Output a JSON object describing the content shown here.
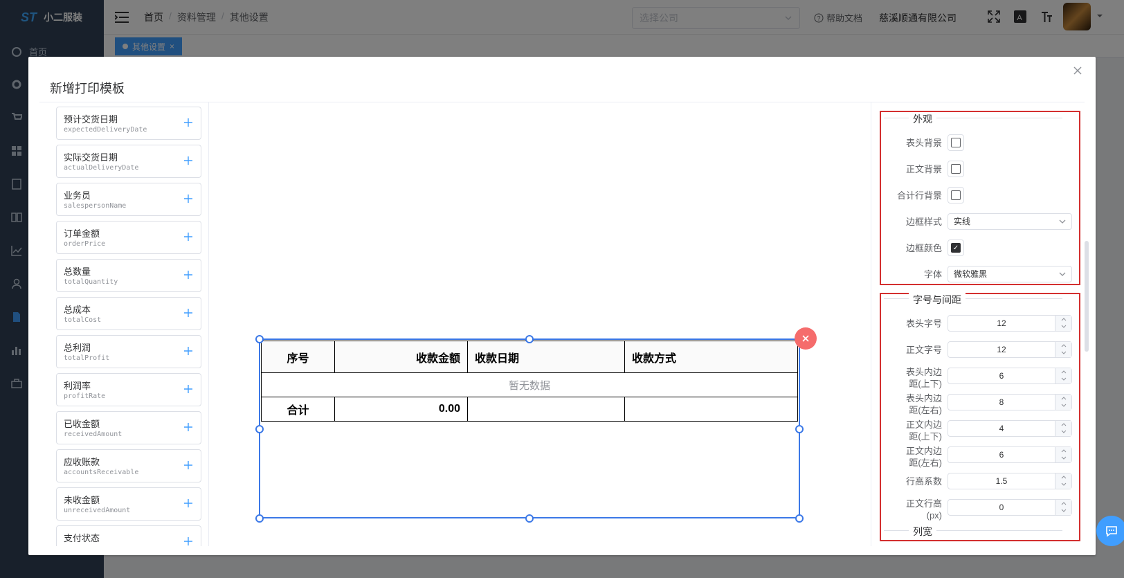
{
  "app": {
    "name": "小二服装",
    "logo_text": "ST"
  },
  "sidebar": {
    "items": [
      {
        "label": "首页",
        "icon": "dashboard-icon"
      },
      {
        "label": "",
        "icon": "gear-icon"
      },
      {
        "label": "",
        "icon": "cart-icon"
      },
      {
        "label": "",
        "icon": "grid-icon"
      },
      {
        "label": "",
        "icon": "ledger-icon"
      },
      {
        "label": "",
        "icon": "book-icon"
      },
      {
        "label": "",
        "icon": "chart-icon"
      },
      {
        "label": "",
        "icon": "user-icon"
      },
      {
        "label": "",
        "icon": "document-icon"
      },
      {
        "label": "",
        "icon": "bar-chart-icon"
      },
      {
        "label": "",
        "icon": "briefcase-icon"
      }
    ]
  },
  "navbar": {
    "breadcrumb": [
      "首页",
      "资料管理",
      "其他设置"
    ],
    "company_select_placeholder": "选择公司",
    "help_label": "帮助文档",
    "company_name": "慈溪顺通有限公司"
  },
  "tags": {
    "active": "其他设置"
  },
  "dialog": {
    "title": "新增打印模板",
    "fields": [
      {
        "label": "预计交货日期",
        "key": "expectedDeliveryDate"
      },
      {
        "label": "实际交货日期",
        "key": "actualDeliveryDate"
      },
      {
        "label": "业务员",
        "key": "salespersonName"
      },
      {
        "label": "订单金额",
        "key": "orderPrice"
      },
      {
        "label": "总数量",
        "key": "totalQuantity"
      },
      {
        "label": "总成本",
        "key": "totalCost"
      },
      {
        "label": "总利润",
        "key": "totalProfit"
      },
      {
        "label": "利润率",
        "key": "profitRate"
      },
      {
        "label": "已收金额",
        "key": "receivedAmount"
      },
      {
        "label": "应收账款",
        "key": "accountsReceivable"
      },
      {
        "label": "未收金额",
        "key": "unreceivedAmount"
      },
      {
        "label": "支付状态",
        "key": ""
      }
    ],
    "table": {
      "headers": [
        "序号",
        "收款金额",
        "收款日期",
        "收款方式"
      ],
      "empty_text": "暂无数据",
      "summary": [
        "合计",
        "0.00",
        "",
        ""
      ]
    },
    "props": {
      "appearance": {
        "title": "外观",
        "header_bg_label": "表头背景",
        "body_bg_label": "正文背景",
        "total_bg_label": "合计行背景",
        "border_style_label": "边框样式",
        "border_style_value": "实线",
        "border_color_label": "边框颜色",
        "font_label": "字体",
        "font_value": "微软雅黑"
      },
      "spacing": {
        "title": "字号与间距",
        "header_font_label": "表头字号",
        "header_font_value": "12",
        "body_font_label": "正文字号",
        "body_font_value": "12",
        "header_pad_v_label": "表头内边距(上下)",
        "header_pad_v_value": "6",
        "header_pad_h_label": "表头内边距(左右)",
        "header_pad_h_value": "8",
        "body_pad_v_label": "正文内边距(上下)",
        "body_pad_v_value": "4",
        "body_pad_h_label": "正文内边距(左右)",
        "body_pad_h_value": "6",
        "line_height_label": "行高系数",
        "line_height_value": "1.5",
        "body_row_h_label": "正文行高(px)",
        "body_row_h_value": "0"
      },
      "column_width_title": "列宽"
    }
  },
  "colors": {
    "accent": "#409eff",
    "selection": "#3b78e7",
    "danger": "#f56c6c",
    "highlight_border": "#d32f2f"
  }
}
